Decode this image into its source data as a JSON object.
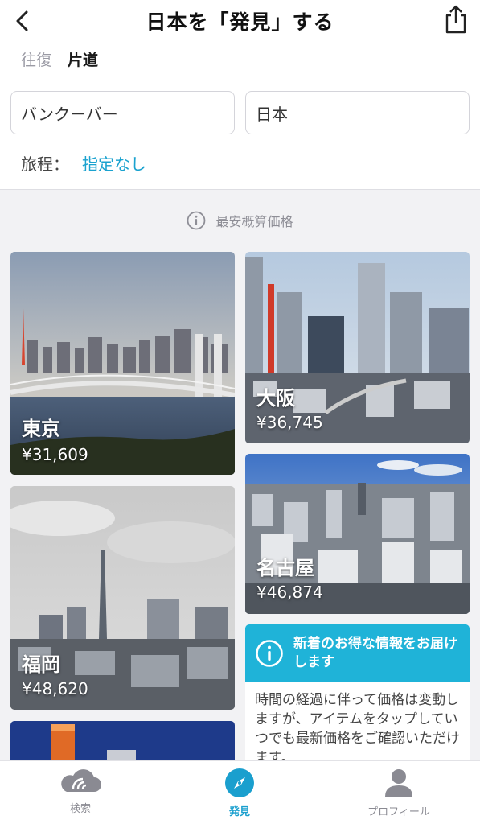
{
  "header": {
    "title": "日本を「発見」する"
  },
  "trip_types": [
    {
      "label": "往復",
      "active": false
    },
    {
      "label": "片道",
      "active": true
    }
  ],
  "origin": {
    "value": "バンクーバー"
  },
  "destination": {
    "value": "日本"
  },
  "itinerary": {
    "label": "旅程：",
    "value": "指定なし"
  },
  "price_note": "最安概算価格",
  "destinations": [
    {
      "city": "東京",
      "price": "¥31,609"
    },
    {
      "city": "大阪",
      "price": "¥36,745"
    },
    {
      "city": "名古屋",
      "price": "¥46,874"
    },
    {
      "city": "福岡",
      "price": "¥48,620"
    }
  ],
  "info_card": {
    "title": "新着のお得な情報をお届けします",
    "body": "時間の経過に伴って価格は変動しますが、アイテムをタップしていつでも最新価格をご確認いただけます。"
  },
  "tabs": [
    {
      "label": "検索",
      "icon": "cloud-search-icon",
      "active": false
    },
    {
      "label": "発見",
      "icon": "compass-icon",
      "active": true
    },
    {
      "label": "プロフィール",
      "icon": "profile-icon",
      "active": false
    }
  ],
  "colors": {
    "accent": "#1aa2cf",
    "info_header": "#1fb3d8",
    "background": "#f2f2f4"
  }
}
